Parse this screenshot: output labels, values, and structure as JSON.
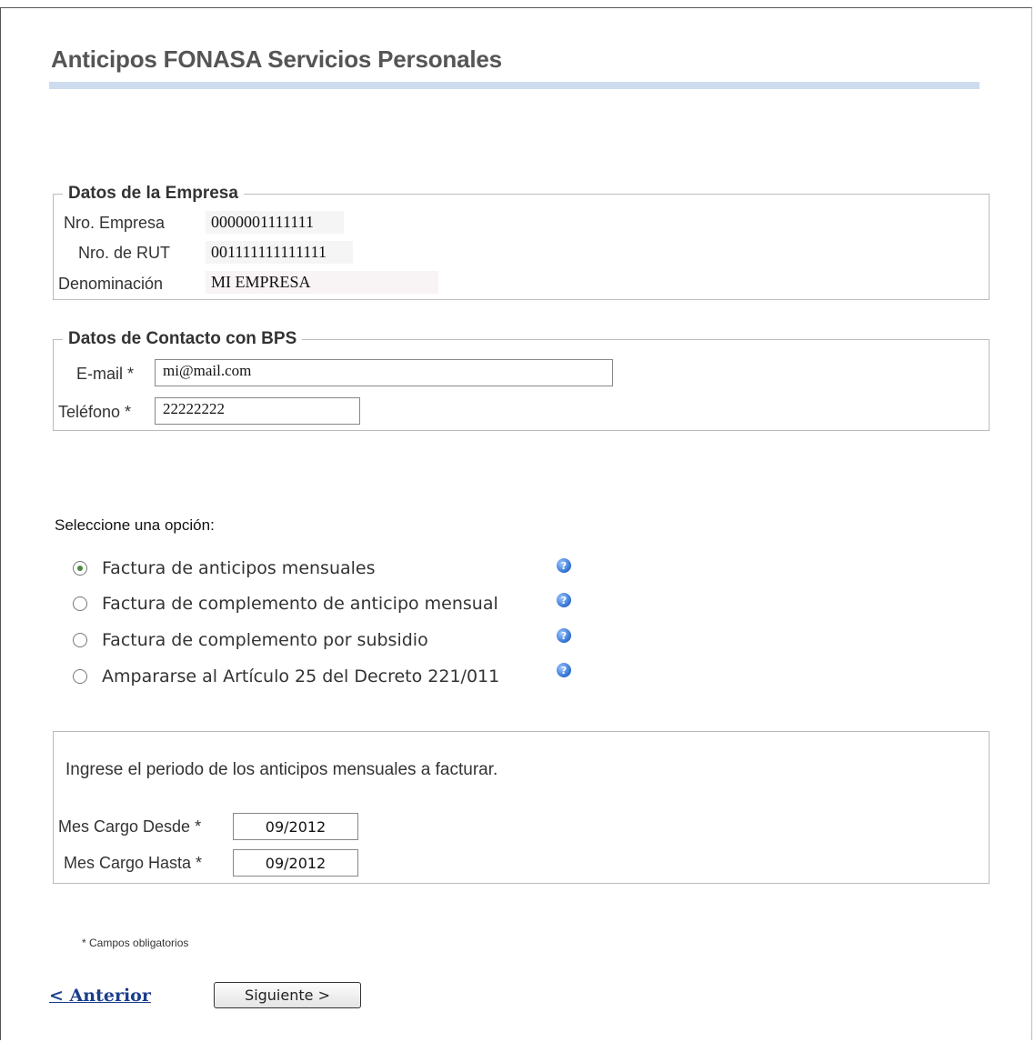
{
  "page": {
    "title": "Anticipos FONASA Servicios Personales"
  },
  "empresa": {
    "legend": "Datos de la Empresa",
    "nro_empresa_label": "Nro. Empresa",
    "nro_empresa_value": "0000001111111",
    "rut_label": "Nro. de RUT",
    "rut_value": "001111111111111",
    "denominacion_label": "Denominación",
    "denominacion_value": "MI EMPRESA"
  },
  "contacto": {
    "legend": "Datos de Contacto con BPS",
    "email_label": "E-mail *",
    "email_value": "mi@mail.com",
    "telefono_label": "Teléfono *",
    "telefono_value": "22222222"
  },
  "opciones": {
    "heading": "Seleccione una opción:",
    "items": [
      {
        "label": "Factura de anticipos mensuales",
        "selected": true
      },
      {
        "label": "Factura de complemento de anticipo mensual",
        "selected": false
      },
      {
        "label": "Factura de complemento por subsidio",
        "selected": false
      },
      {
        "label": "Ampararse al Artículo 25 del Decreto 221/011",
        "selected": false
      }
    ],
    "help_icon": "help-icon"
  },
  "periodo": {
    "instruction": "Ingrese el periodo de los anticipos mensuales a facturar.",
    "desde_label": "Mes Cargo Desde *",
    "desde_value": "09/2012",
    "hasta_label": "Mes Cargo Hasta *",
    "hasta_value": "09/2012"
  },
  "footer": {
    "note": "* Campos obligatorios",
    "prev_label": "< Anterior",
    "next_label": "Siguiente >"
  },
  "colors": {
    "accent_bar": "#cddcee",
    "link": "#1a3e8c",
    "radio_selected": "#4a8a3a"
  }
}
